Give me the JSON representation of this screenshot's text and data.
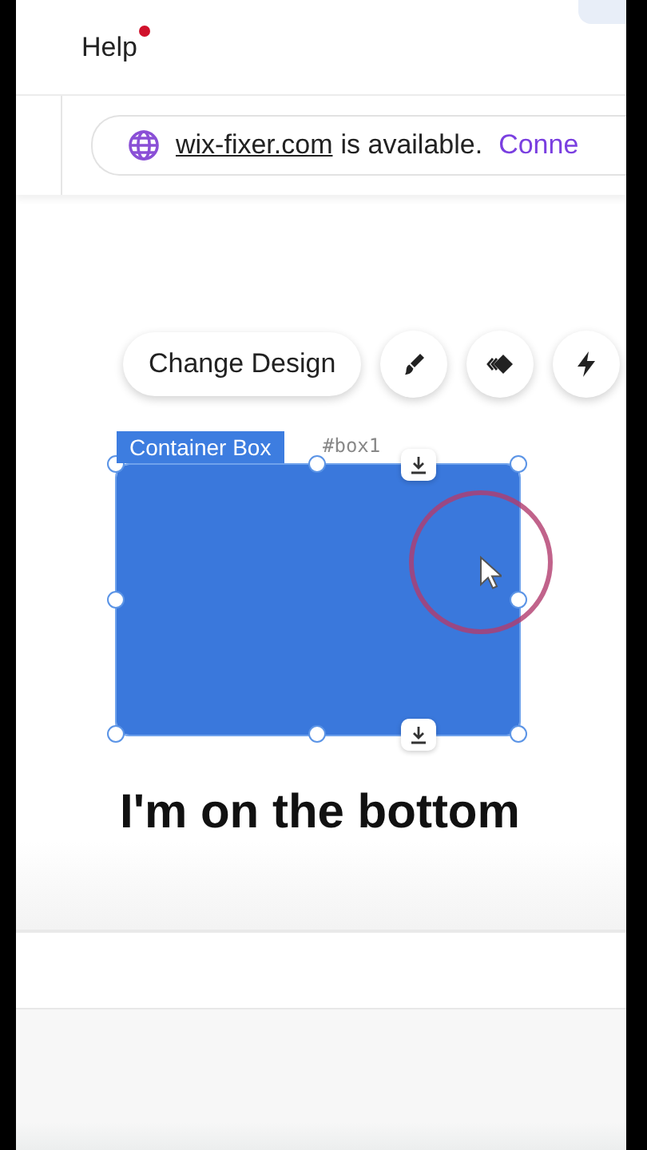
{
  "header": {
    "menu_items": [
      {
        "label": "Help",
        "notification": true
      }
    ]
  },
  "domain_banner": {
    "domain": "wix-fixer.com",
    "message": "is available.",
    "action": "Conne"
  },
  "toolbar": {
    "buttons": [
      {
        "kind": "text",
        "label": "Change Design"
      },
      {
        "kind": "brush"
      },
      {
        "kind": "animation"
      },
      {
        "kind": "lightning"
      }
    ]
  },
  "canvas": {
    "elements": [
      {
        "kind": "container",
        "label": "Container Box",
        "id_text": "#box1",
        "selected": true
      },
      {
        "kind": "heading",
        "text": "I'm on the bottom"
      }
    ]
  }
}
